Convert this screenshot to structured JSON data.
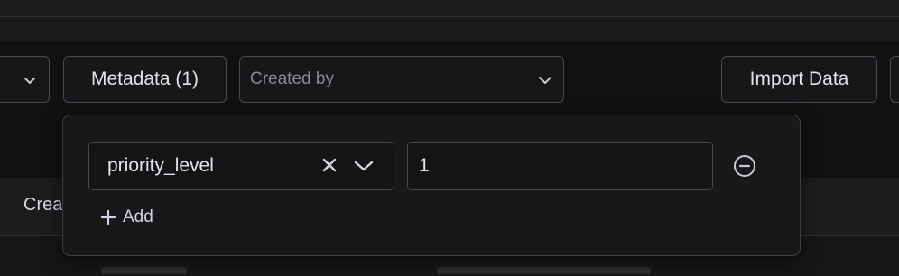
{
  "toolbar": {
    "metadata_button": "Metadata (1)",
    "created_by": {
      "placeholder": "Created by"
    },
    "import_button": "Import Data"
  },
  "metadata_filter": {
    "key": "priority_level",
    "value": "1",
    "add_label": "Add"
  },
  "table": {
    "first_column_header": "Crea"
  },
  "icons": {
    "dropdown": "chevron-down-icon",
    "clear": "close-icon",
    "remove": "minus-circle-icon",
    "add": "plus-icon"
  }
}
